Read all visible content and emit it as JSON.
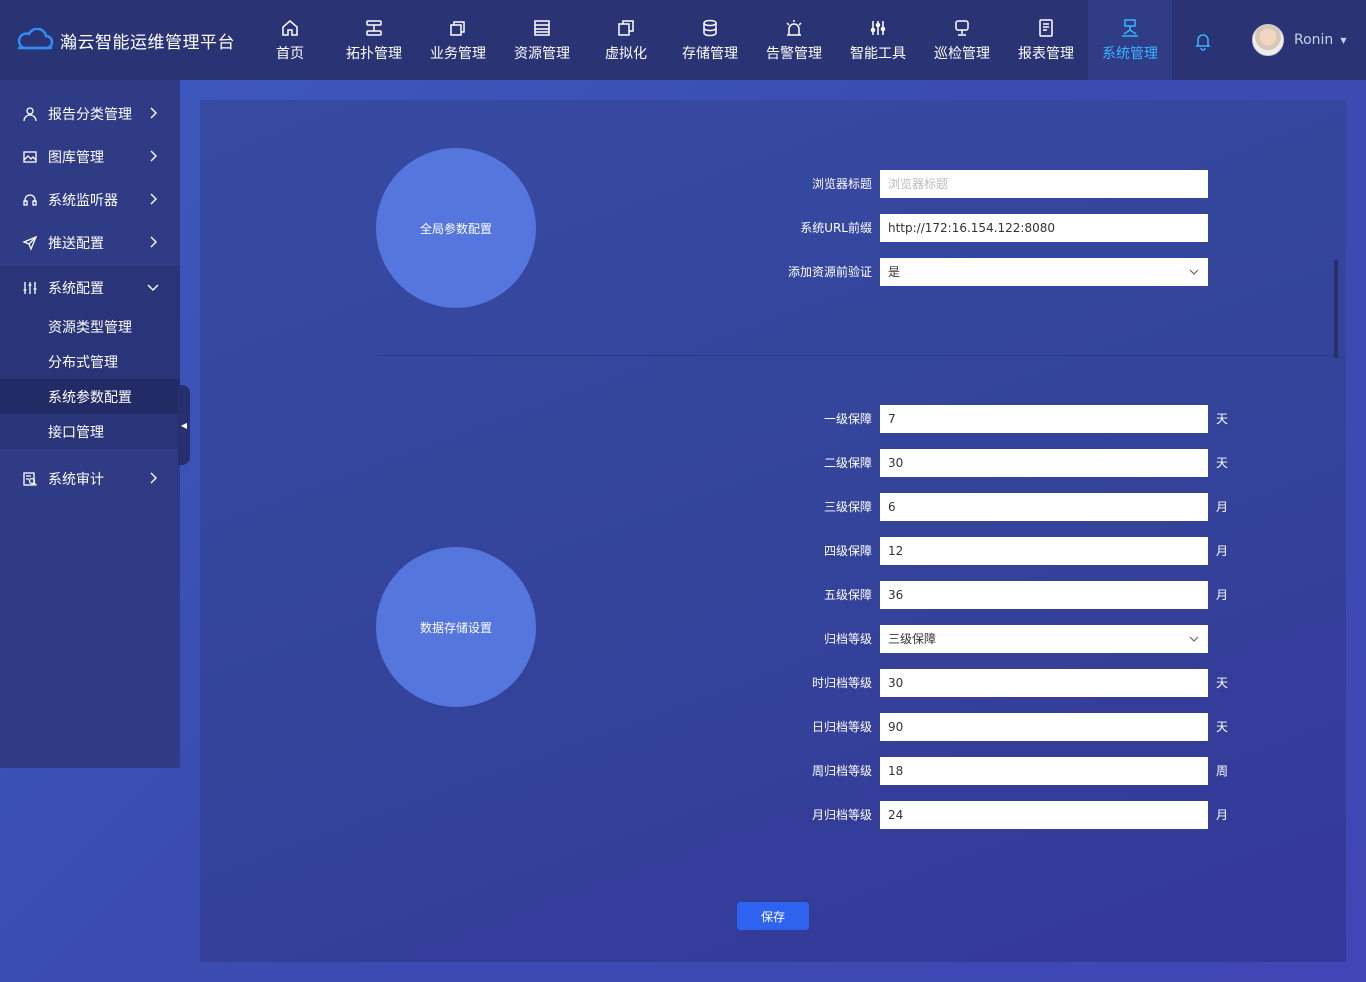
{
  "app": {
    "title": "瀚云智能运维管理平台",
    "accent": "#38b6ff",
    "topbar_bg": "#2a3373",
    "user_name": "Ronin"
  },
  "nav": [
    {
      "label": "首页",
      "icon": "home-icon"
    },
    {
      "label": "拓扑管理",
      "icon": "topology-icon"
    },
    {
      "label": "业务管理",
      "icon": "business-icon"
    },
    {
      "label": "资源管理",
      "icon": "resource-icon"
    },
    {
      "label": "虚拟化",
      "icon": "virtual-icon"
    },
    {
      "label": "存储管理",
      "icon": "database-icon"
    },
    {
      "label": "告警管理",
      "icon": "alarm-icon"
    },
    {
      "label": "智能工具",
      "icon": "tools-icon"
    },
    {
      "label": "巡检管理",
      "icon": "inspection-icon"
    },
    {
      "label": "报表管理",
      "icon": "report-icon"
    },
    {
      "label": "系统管理",
      "icon": "system-icon",
      "active": true
    }
  ],
  "sidebar": {
    "items": [
      {
        "label": "报告分类管理",
        "icon": "user-icon"
      },
      {
        "label": "图库管理",
        "icon": "image-icon"
      },
      {
        "label": "系统监听器",
        "icon": "headset-icon"
      },
      {
        "label": "推送配置",
        "icon": "send-icon"
      },
      {
        "label": "系统配置",
        "icon": "sliders-icon",
        "expanded": true
      },
      {
        "label": "系统审计",
        "icon": "audit-icon"
      }
    ],
    "sub_items": [
      {
        "label": "资源类型管理"
      },
      {
        "label": "分布式管理"
      },
      {
        "label": "系统参数配置",
        "active": true
      },
      {
        "label": "接口管理"
      }
    ]
  },
  "sections": {
    "global": {
      "title": "全局参数配置"
    },
    "storage": {
      "title": "数据存储设置"
    }
  },
  "global_fields": [
    {
      "label": "浏览器标题",
      "value": "",
      "placeholder": "浏览器标题"
    },
    {
      "label": "系统URL前缀",
      "value": "http://172:16.154.122:8080"
    },
    {
      "label": "添加资源前验证",
      "value": "是",
      "type": "select"
    }
  ],
  "storage_fields": [
    {
      "label": "一级保障",
      "value": "7",
      "unit": "天"
    },
    {
      "label": "二级保障",
      "value": "30",
      "unit": "天"
    },
    {
      "label": "三级保障",
      "value": "6",
      "unit": "月"
    },
    {
      "label": "四级保障",
      "value": "12",
      "unit": "月"
    },
    {
      "label": "五级保障",
      "value": "36",
      "unit": "月"
    },
    {
      "label": "归档等级",
      "value": "三级保障",
      "type": "select"
    },
    {
      "label": "时归档等级",
      "value": "30",
      "unit": "天"
    },
    {
      "label": "日归档等级",
      "value": "90",
      "unit": "天"
    },
    {
      "label": "周归档等级",
      "value": "18",
      "unit": "周"
    },
    {
      "label": "月归档等级",
      "value": "24",
      "unit": "月"
    }
  ],
  "save_label": "保存"
}
